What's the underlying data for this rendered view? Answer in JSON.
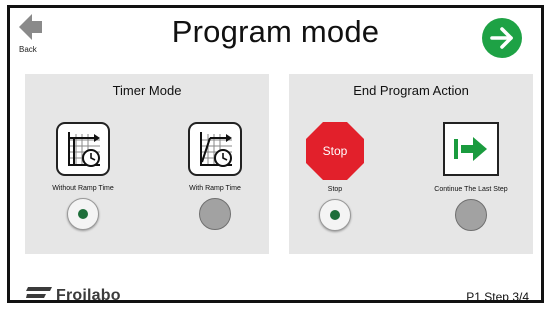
{
  "header": {
    "back_label": "Back",
    "title": "Program mode"
  },
  "timer_mode": {
    "title": "Timer Mode",
    "options": [
      {
        "label": "Without  Ramp Time",
        "selected": true
      },
      {
        "label": "With Ramp Time",
        "selected": false
      }
    ]
  },
  "end_action": {
    "title": "End Program Action",
    "options": [
      {
        "label": "Stop",
        "icon_text": "Stop",
        "selected": true
      },
      {
        "label": "Continue The Last Step",
        "selected": false
      }
    ]
  },
  "footer": {
    "logo_text": "Froilabo",
    "step": "P1 Step 3/4"
  },
  "colors": {
    "next_green": "#1ea245",
    "stop_red": "#e2202b",
    "continue_green": "#1a9b3e",
    "radio_dot": "#1e6e3a",
    "panel_bg": "#e6e6e6"
  },
  "icons": [
    "arrow-left-icon",
    "arrow-right-circle-icon",
    "chart-clock-no-ramp-icon",
    "chart-clock-ramp-icon",
    "stop-sign-icon",
    "continue-arrow-icon",
    "froilabo-logo-icon"
  ]
}
